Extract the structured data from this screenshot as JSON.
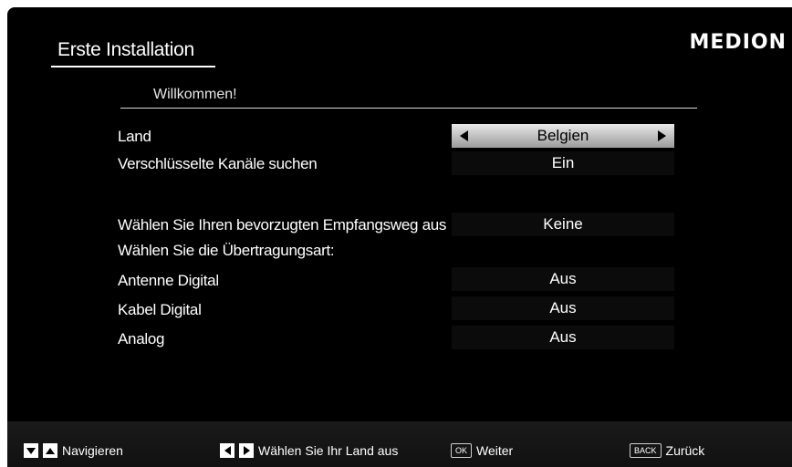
{
  "header": {
    "title": "Erste Installation",
    "logo": "MEDION"
  },
  "welcome": "Willkommen!",
  "rows": [
    {
      "label": "Land",
      "value": "Belgien",
      "selected": true
    },
    {
      "label": "Verschlüsselte Kanäle suchen",
      "value": "Ein"
    },
    {
      "label": "Wählen Sie Ihren bevorzugten Empfangsweg aus",
      "value": "Keine"
    },
    {
      "label": "Wählen Sie die Übertragungsart:"
    },
    {
      "label": "Antenne Digital",
      "value": "Aus"
    },
    {
      "label": "Kabel Digital",
      "value": "Aus"
    },
    {
      "label": "Analog",
      "value": "Aus"
    }
  ],
  "footer": {
    "navigate": "Navigieren",
    "select_country": "Wählen Sie Ihr Land aus",
    "ok_key": "OK",
    "next": "Weiter",
    "back_key": "BACK",
    "back": "Zurück"
  },
  "colors": {
    "background": "#000000",
    "selected_row": "#c8c8c8",
    "value_box": "#0b0b0b"
  }
}
